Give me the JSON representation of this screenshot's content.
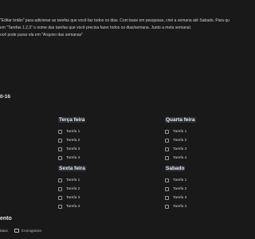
{
  "intro": {
    "line1": "\"Editar botão\" para adicionar as tarefas que você faz todos os dias. Com base em pesquisas, criei a semana até Sabado. Para qu",
    "line2": "em \"Tarefas 1,2,3\" o nome das tarefas que você precisa fazer todos os dias/semana. Junto a meta semanal.",
    "line3": "ocê pode puxar ela em \"Arquivo das semanas\""
  },
  "week_label": "0-16",
  "days": [
    {
      "name": "Terça feira",
      "tasks": [
        {
          "label": "Tarefa 1",
          "checked": false
        },
        {
          "label": "Tarefa 2",
          "checked": false
        },
        {
          "label": "Tarefa 3",
          "checked": false
        },
        {
          "label": "Tarefa 4",
          "checked": false
        }
      ]
    },
    {
      "name": "Quarta feira",
      "tasks": [
        {
          "label": "Tarefa 1",
          "checked": false
        },
        {
          "label": "Tarefa 2",
          "checked": false
        },
        {
          "label": "Tarefa 3",
          "checked": false
        },
        {
          "label": "Tarefa 4",
          "checked": false
        }
      ]
    },
    {
      "name": "Sexta feira",
      "tasks": [
        {
          "label": "Tarefa 1",
          "checked": false
        },
        {
          "label": "Tarefa 2",
          "checked": false
        },
        {
          "label": "Tarefa 3",
          "checked": false
        },
        {
          "label": "Tarefa 4",
          "checked": false
        }
      ]
    },
    {
      "name": "Sabado",
      "tasks": [
        {
          "label": "Tarefa 1",
          "checked": false
        },
        {
          "label": "Tarefa 2",
          "checked": false
        },
        {
          "label": "Tarefa 3",
          "checked": false
        },
        {
          "label": "Tarefa 4",
          "checked": false
        }
      ]
    }
  ],
  "section_title": "ento",
  "tabs": [
    {
      "label": "tatus",
      "icon": "status-icon"
    },
    {
      "label": "Cronograma",
      "icon": "calendar-icon"
    }
  ]
}
